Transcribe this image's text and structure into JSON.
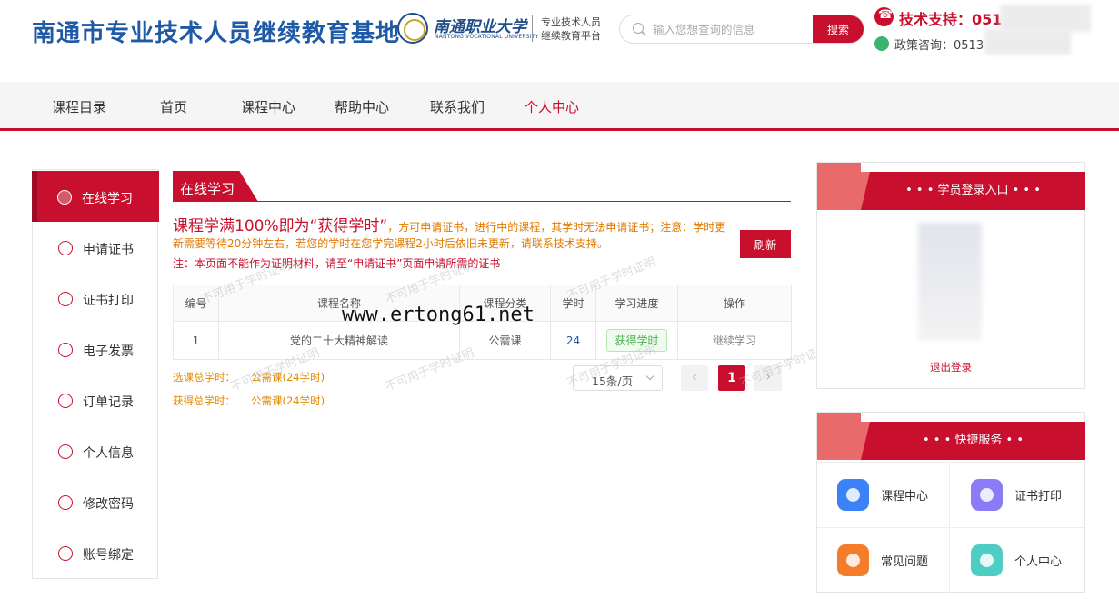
{
  "header": {
    "site_title": "南通市专业技术人员继续教育基地",
    "logo_cn": "南通职业大学",
    "logo_en": "NANTONG VOCATIONAL UNIVERSITY",
    "platform_line1": "专业技术人员",
    "platform_line2": "继续教育平台",
    "search_placeholder": "输入您想查询的信息",
    "search_button": "搜索",
    "tech_support": "技术支持：051",
    "policy": "政策咨询：0513"
  },
  "nav": {
    "items": [
      "课程目录",
      "首页",
      "课程中心",
      "帮助中心",
      "联系我们",
      "个人中心"
    ],
    "active": "个人中心"
  },
  "sidebar": {
    "items": [
      {
        "label": "在线学习"
      },
      {
        "label": "申请证书"
      },
      {
        "label": "证书打印"
      },
      {
        "label": "电子发票"
      },
      {
        "label": "订单记录"
      },
      {
        "label": "个人信息"
      },
      {
        "label": "修改密码"
      },
      {
        "label": "账号绑定"
      }
    ]
  },
  "main": {
    "tab_title": "在线学习",
    "notice_big": "课程学满100%即为“获得学时”",
    "notice_rest": "，方可申请证书，进行中的课程，其学时无法申请证书；注意：学时更新需要等待20分钟左右，若您的学时在您学完课程2小时后依旧未更新，请联系技术支持。",
    "notice_line2": "注：本页面不能作为证明材料，请至“申请证书”页面申请所需的证书",
    "refresh": "刷新",
    "table": {
      "headers": [
        "编号",
        "课程名称",
        "课程分类",
        "学时",
        "学习进度",
        "操作"
      ],
      "rows": [
        {
          "no": "1",
          "name": "党的二十大精神解读",
          "category": "公需课",
          "hours": "24",
          "progress": "获得学时",
          "action": "继续学习"
        }
      ]
    },
    "stat_selected_label": "选课总学时：",
    "stat_selected_value": "公需课(24学时)",
    "stat_obtained_label": "获得总学时：",
    "stat_obtained_value": "公需课(24学时)",
    "page_size": "15条/页",
    "prev": "‹",
    "current_page": "1",
    "next": "›"
  },
  "watermark": {
    "text": "不可用于学时证明",
    "url": "www.ertong61.net"
  },
  "login_panel": {
    "title": "• • • 学员登录入口 • • •",
    "logout": "退出登录"
  },
  "quick_panel": {
    "title": "• • •    快捷服务    • •",
    "items": [
      {
        "label": "课程中心",
        "color": "#3b82f6"
      },
      {
        "label": "证书打印",
        "color": "#8b7cf6"
      },
      {
        "label": "常见问题",
        "color": "#f57c2b"
      },
      {
        "label": "个人中心",
        "color": "#4ecdc4"
      }
    ]
  },
  "colors": {
    "brand_red": "#c8102e",
    "brand_blue": "#1f5aa6"
  }
}
